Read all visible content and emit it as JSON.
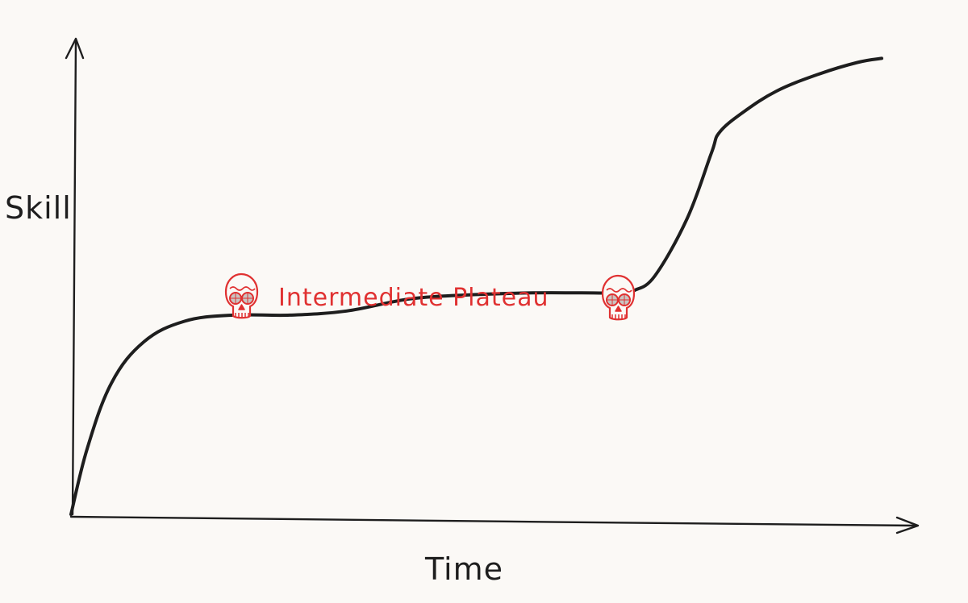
{
  "chart_data": {
    "type": "line",
    "xlabel": "Time",
    "ylabel": "Skill",
    "annotation": "Intermediate Plateau",
    "annotation_icon": "skull-icon",
    "series": [
      {
        "x": [
          0,
          2,
          5,
          9,
          14,
          20,
          27,
          34,
          42,
          50,
          57,
          63,
          68.5,
          69.5,
          72,
          76,
          79,
          80,
          83,
          87,
          92,
          97,
          100
        ],
        "y": [
          0,
          16,
          32,
          42,
          47,
          48.5,
          48.5,
          49.5,
          52.5,
          53.5,
          53.9,
          53.9,
          53.9,
          54.5,
          58,
          72,
          88,
          93,
          98,
          103,
          107,
          110,
          111
        ]
      }
    ],
    "xlim": [
      0,
      100
    ],
    "ylim": [
      0,
      115
    ],
    "grid": false
  },
  "colors": {
    "ink": "#1e1e1e",
    "accent": "#e03131",
    "background": "#fbf9f6"
  }
}
